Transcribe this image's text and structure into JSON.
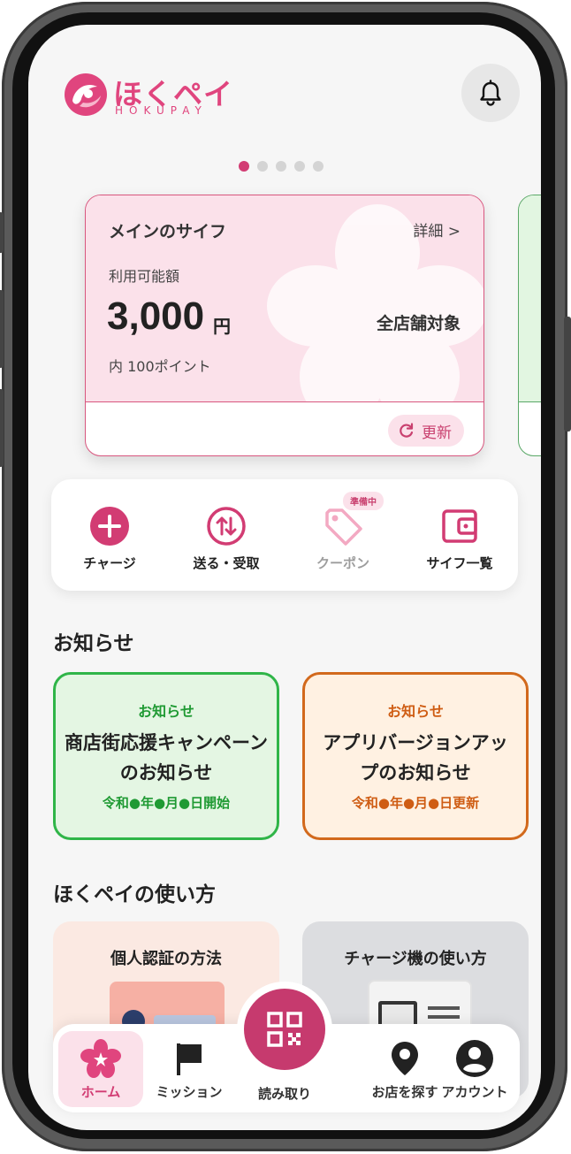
{
  "header": {
    "logo_text": "ほくペイ",
    "logo_sub": "HOKUPAY"
  },
  "carousel": {
    "count": 5,
    "active_index": 0
  },
  "wallet": {
    "name": "メインのサイフ",
    "detail_link": "詳細 >",
    "available_label": "利用可能額",
    "balance": "3,000",
    "unit": "円",
    "points": "内 100ポイント",
    "scope": "全店舗対象",
    "refresh_label": "更新"
  },
  "actions": [
    {
      "label": "チャージ",
      "icon": "plus-circle-icon"
    },
    {
      "label": "送る・受取",
      "icon": "transfer-icon"
    },
    {
      "label": "クーポン",
      "icon": "coupon-tag-icon",
      "badge": "準備中",
      "disabled": true
    },
    {
      "label": "サイフ一覧",
      "icon": "wallet-icon"
    }
  ],
  "news": {
    "title": "お知らせ",
    "items": [
      {
        "tag": "お知らせ",
        "title": "商店街応援キャンペーンのお知らせ",
        "date": "令和●年●月●日開始",
        "color": "#2fb548"
      },
      {
        "tag": "お知らせ",
        "title": "アプリバージョンアップのお知らせ",
        "date": "令和●年●月●日更新",
        "color": "#d2691c"
      }
    ]
  },
  "howto": {
    "title": "ほくペイの使い方",
    "items": [
      {
        "title": "個人認証の方法"
      },
      {
        "title": "チャージ機の使い方"
      }
    ]
  },
  "nav": {
    "items": [
      {
        "label": "ホーム",
        "icon": "sakura-icon",
        "active": true
      },
      {
        "label": "ミッション",
        "icon": "flag-icon"
      },
      {
        "label": "読み取り",
        "icon": "qr-code-icon"
      },
      {
        "label": "お店を探す",
        "icon": "map-pin-icon"
      },
      {
        "label": "アカウント",
        "icon": "account-icon"
      }
    ]
  },
  "colors": {
    "accent": "#d23c73",
    "wallet_bg": "#fbe1ea",
    "screen_bg": "#f6f6f6"
  }
}
